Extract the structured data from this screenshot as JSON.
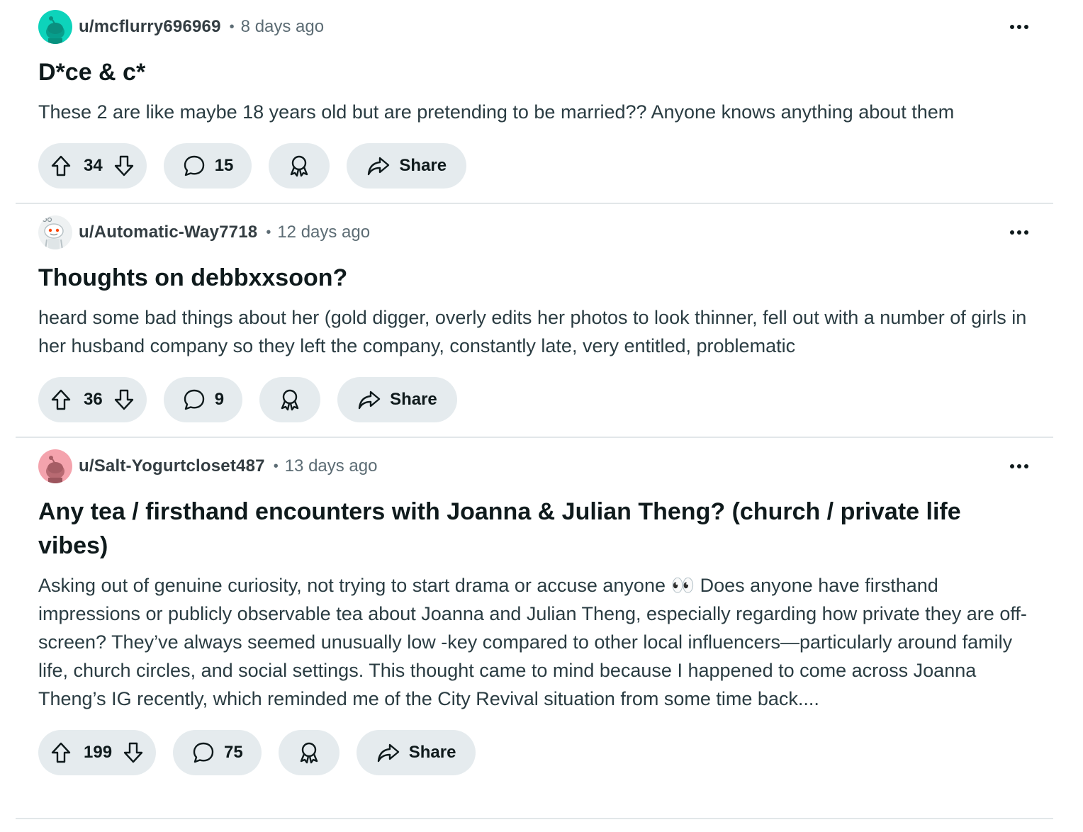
{
  "posts": [
    {
      "username": "u/mcflurry696969",
      "separator": "•",
      "time": "8 days ago",
      "title": "D*ce & c*",
      "body": "These 2 are like maybe 18 years old but are pretending to be married?? Anyone knows anything about them",
      "votes": "34",
      "comments": "15",
      "share_label": "Share",
      "avatar_color": "#0dd3bb"
    },
    {
      "username": "u/Automatic-Way7718",
      "separator": "•",
      "time": "12 days ago",
      "title": "Thoughts on debbxxsoon?",
      "body": "heard some bad things about her (gold digger, overly edits her photos to look thinner, fell out with a number of girls in her husband company so they left the company, constantly late, very entitled, problematic",
      "votes": "36",
      "comments": "9",
      "share_label": "Share",
      "avatar_color": "#e9edef"
    },
    {
      "username": "u/Salt-Yogurtcloset487",
      "separator": "•",
      "time": "13 days ago",
      "title": "Any tea / firsthand encounters with Joanna & Julian Theng? (church / private life vibes)",
      "body": "Asking out of genuine curiosity, not trying to start drama or accuse anyone 👀 Does anyone have firsthand impressions or publicly observable tea about Joanna and Julian Theng, especially regarding how private they are off-screen? They’ve always seemed unusually low -key compared to other local influencers—particularly around family life, church circles, and social settings. This thought came to mind because I happened to come across Joanna Theng’s IG recently, which reminded me of the City Revival situation from some time back....",
      "votes": "199",
      "comments": "75",
      "share_label": "Share",
      "avatar_color": "#f4a3ad"
    }
  ],
  "icons": {
    "upvote": "upvote-icon",
    "downvote": "downvote-icon",
    "comment": "comment-icon",
    "award": "award-icon",
    "share": "share-icon",
    "more": "more-options-icon"
  }
}
